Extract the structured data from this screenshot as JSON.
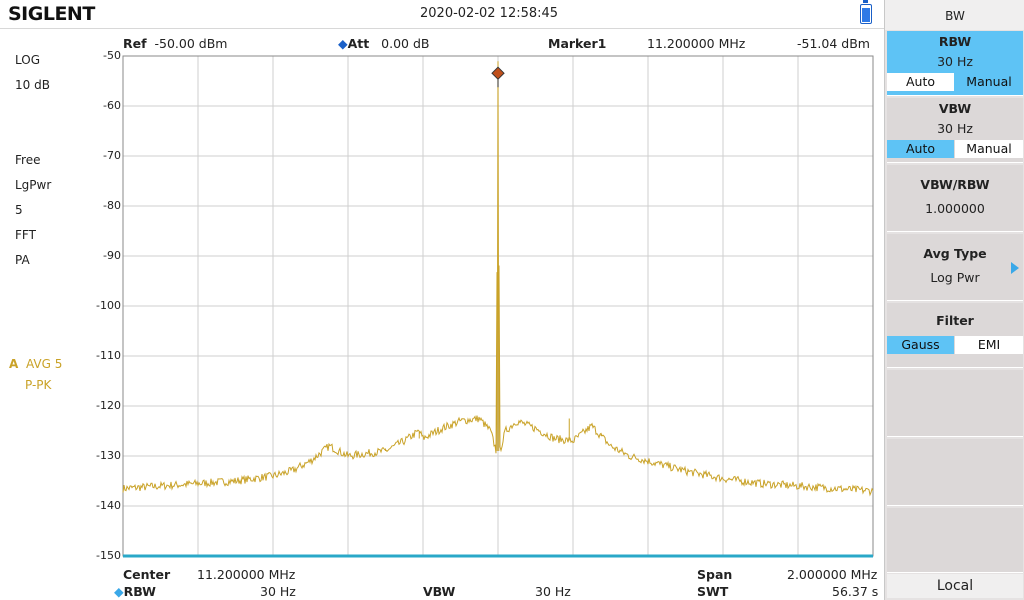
{
  "header": {
    "brand": "SIGLENT",
    "datetime": "2020-02-02   12:58:45"
  },
  "info": {
    "ref_label": "Ref",
    "ref_value": "-50.00 dBm",
    "att_label": "Att",
    "att_value": "0.00 dB",
    "marker_label": "Marker1",
    "marker_freq": "11.200000 MHz",
    "marker_level": "-51.04 dBm"
  },
  "left": {
    "scale": "LOG",
    "div": "10 dB",
    "trig": "Free",
    "avg_mode": "LgPwr",
    "avg_count": "5",
    "sweep": "FFT",
    "preamp": "PA",
    "trace_letter": "A",
    "trace_mode": "AVG 5",
    "detector": "P-PK"
  },
  "bottom": {
    "center_label": "Center",
    "center_value": "11.200000 MHz",
    "span_label": "Span",
    "span_value": "2.000000 MHz",
    "rbw_label": "RBW",
    "rbw_value": "30 Hz",
    "vbw_label": "VBW",
    "vbw_value": "30 Hz",
    "swt_label": "SWT",
    "swt_value": "56.37 s"
  },
  "panel": {
    "title": "BW",
    "rbw": {
      "name": "RBW",
      "value": "30 Hz",
      "auto": "Auto",
      "manual": "Manual"
    },
    "vbw": {
      "name": "VBW",
      "value": "30 Hz",
      "auto": "Auto",
      "manual": "Manual"
    },
    "ratio": {
      "name": "VBW/RBW",
      "value": "1.000000"
    },
    "avg_type": {
      "name": "Avg Type",
      "value": "Log Pwr"
    },
    "filter": {
      "name": "Filter",
      "gauss": "Gauss",
      "emi": "EMI"
    },
    "local": "Local"
  },
  "chart_data": {
    "type": "line",
    "x_center_mhz": 11.2,
    "x_span_mhz": 2.0,
    "ylim": [
      -150,
      -50
    ],
    "yticks": [
      -50,
      -60,
      -70,
      -80,
      -90,
      -100,
      -110,
      -120,
      -130,
      -140,
      -150
    ],
    "trace_color": "#c9a227",
    "marker": {
      "x_mhz": 11.2,
      "y_dbm": -51.04
    },
    "series": [
      {
        "x_mhz": [
          10.2,
          10.3,
          10.4,
          10.5,
          10.6,
          10.65,
          10.7,
          10.75,
          10.8,
          10.85,
          10.9,
          10.95,
          10.99,
          11.0,
          11.05,
          11.1,
          11.15,
          11.18,
          11.195,
          11.2,
          11.205,
          11.22,
          11.25,
          11.3,
          11.35,
          11.4,
          11.45,
          11.5,
          11.55,
          11.6,
          11.7,
          11.8,
          11.9,
          12.0,
          12.1,
          12.2
        ],
        "y_dbm": [
          -136.5,
          -136,
          -135.5,
          -135,
          -134,
          -133,
          -131,
          -128,
          -130,
          -129.5,
          -129,
          -127,
          -125,
          -126.5,
          -124.5,
          -123,
          -122.5,
          -125,
          -129,
          -51.04,
          -129,
          -125,
          -123,
          -124.5,
          -126.5,
          -127,
          -124,
          -128,
          -130,
          -131,
          -133,
          -134.5,
          -135.5,
          -136,
          -136.5,
          -137
        ]
      }
    ]
  }
}
